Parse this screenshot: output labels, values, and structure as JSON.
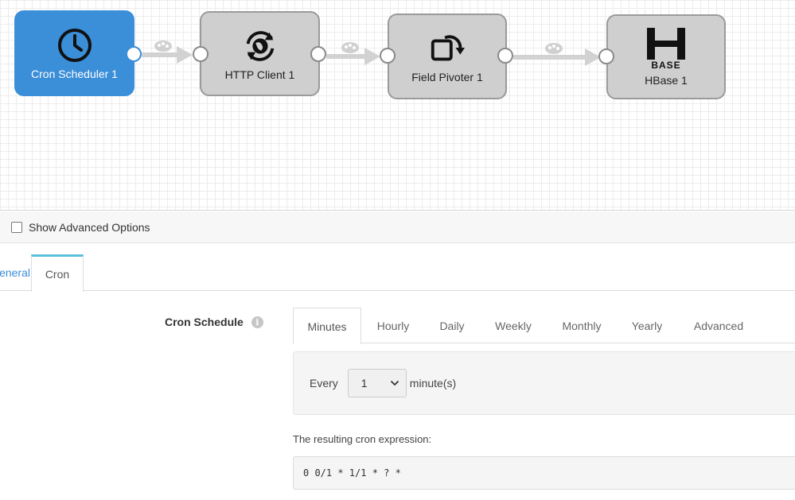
{
  "pipeline": {
    "stages": [
      {
        "label": "Cron Scheduler 1",
        "icon": "clock-icon"
      },
      {
        "label": "HTTP Client 1",
        "icon": "globe-sync-icon"
      },
      {
        "label": "Field Pivoter 1",
        "icon": "pivot-icon"
      },
      {
        "label": "HBase 1",
        "icon": "hbase-logo",
        "logo_text": "BASE"
      }
    ],
    "colors": {
      "origin": "#3b8ed8",
      "processor": "#cfcfcf",
      "connector": "#d2d2d2"
    }
  },
  "options": {
    "show_advanced_label": "Show Advanced Options"
  },
  "config_tabs": [
    {
      "label": "General"
    },
    {
      "label": "Cron"
    }
  ],
  "cron": {
    "field_label": "Cron Schedule",
    "info_icon_text": "i",
    "tabs": [
      {
        "label": "Minutes"
      },
      {
        "label": "Hourly"
      },
      {
        "label": "Daily"
      },
      {
        "label": "Weekly"
      },
      {
        "label": "Monthly"
      },
      {
        "label": "Yearly"
      },
      {
        "label": "Advanced"
      }
    ],
    "every_label": "Every",
    "every_value": "1",
    "unit_label": "minute(s)",
    "result_label": "The resulting cron expression:",
    "result_expression": "0 0/1 * 1/1 * ? *"
  }
}
